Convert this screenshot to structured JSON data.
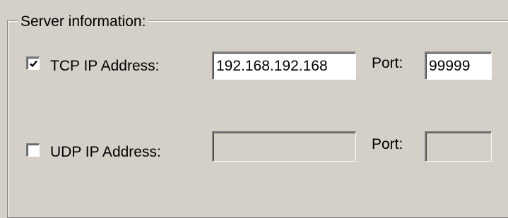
{
  "server_info": {
    "legend": "Server information:",
    "tcp": {
      "checked": true,
      "label": "TCP IP Address:",
      "ip_value": "192.168.192.168",
      "port_label": "Port:",
      "port_value": "99999"
    },
    "udp": {
      "checked": false,
      "label": "UDP IP Address:",
      "ip_value": "",
      "port_label": "Port:",
      "port_value": ""
    }
  }
}
